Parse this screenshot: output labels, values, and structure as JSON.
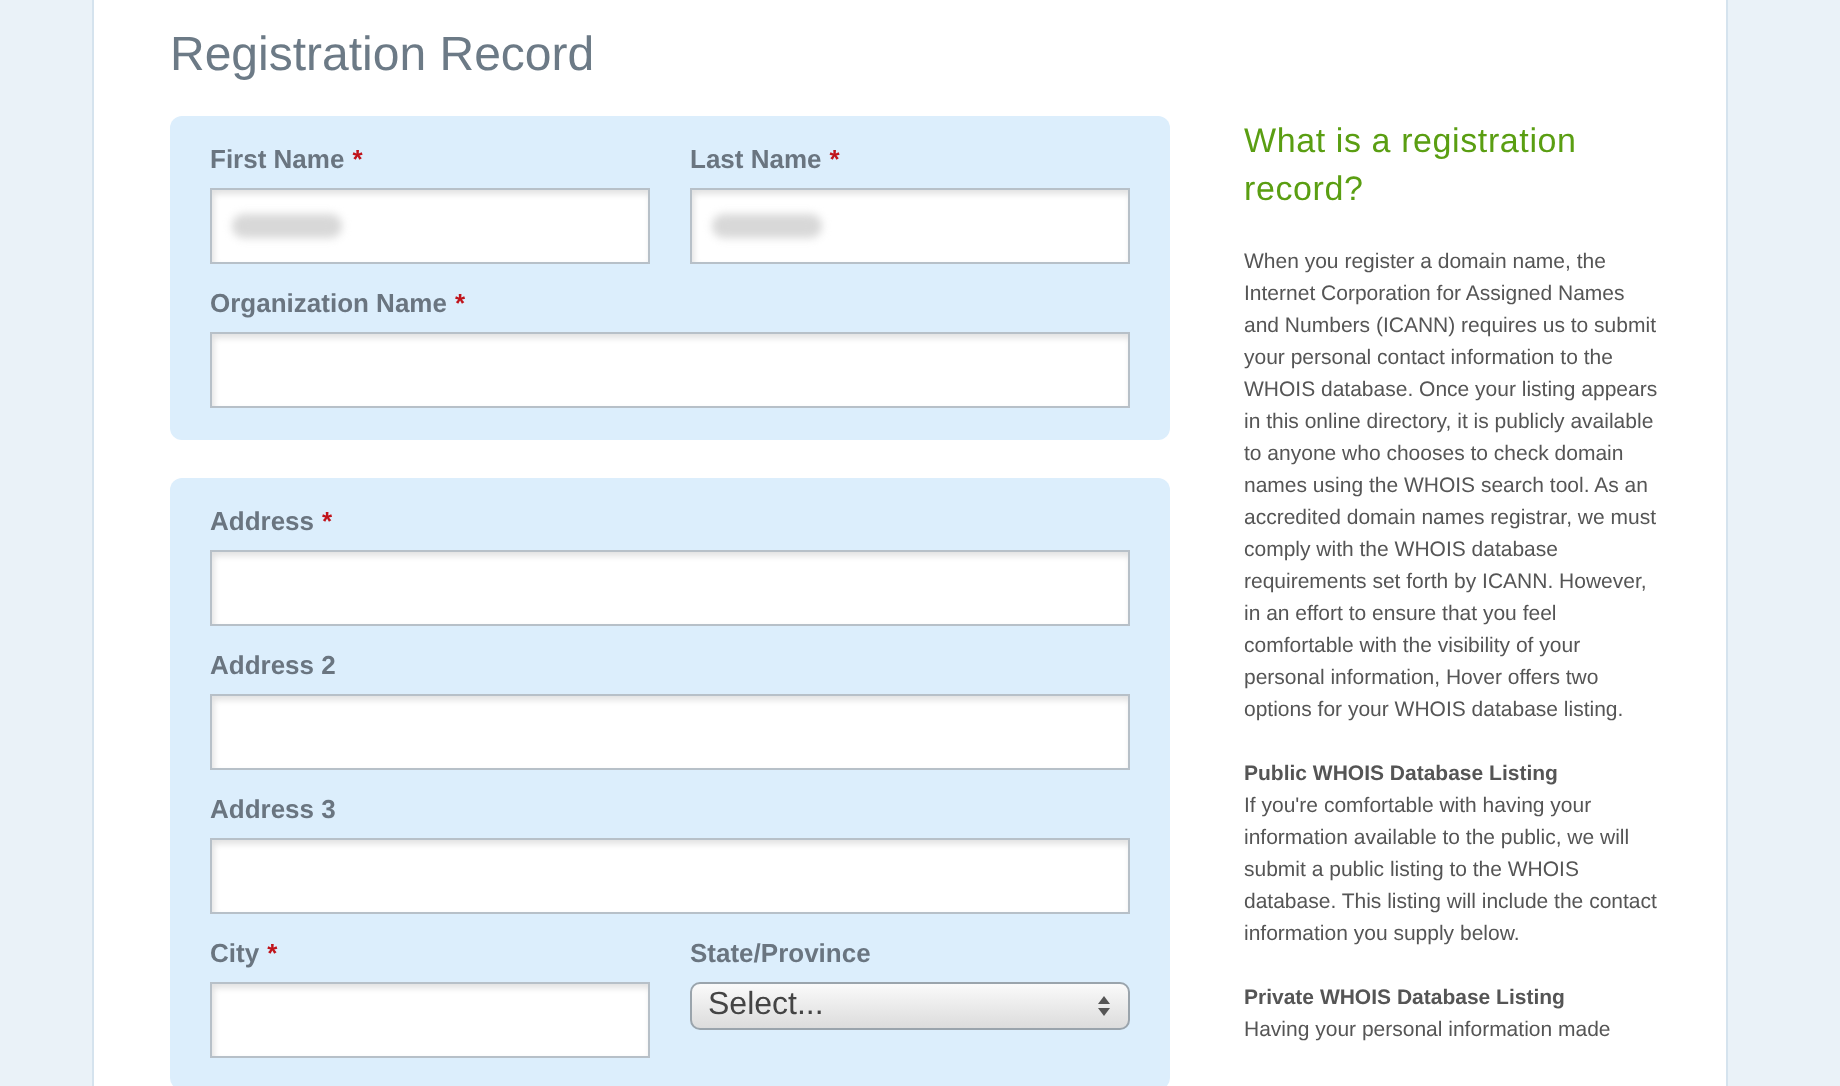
{
  "page_title": "Registration Record",
  "groups": [
    {
      "rows": [
        [
          {
            "label": "First Name",
            "required_mark": "*",
            "kind": "text",
            "redacted": true
          },
          {
            "label": "Last Name",
            "required_mark": "*",
            "kind": "text",
            "redacted": true
          }
        ],
        [
          {
            "label": "Organization Name",
            "required_mark": "*",
            "kind": "text"
          }
        ]
      ]
    },
    {
      "rows": [
        [
          {
            "label": "Address",
            "required_mark": "*",
            "kind": "text"
          }
        ],
        [
          {
            "label": "Address 2",
            "kind": "text"
          }
        ],
        [
          {
            "label": "Address 3",
            "kind": "text"
          }
        ],
        [
          {
            "label": "City",
            "required_mark": "*",
            "kind": "text"
          },
          {
            "label": "State/Province",
            "kind": "select",
            "value": "Select..."
          }
        ]
      ]
    }
  ],
  "sidebar": {
    "heading": "What is a registration record?",
    "intro": "When you register a domain name, the Internet Corporation for Assigned Names and Numbers (ICANN) requires us to submit your personal contact information to the WHOIS database. Once your listing appears in this online directory, it is publicly available to anyone who chooses to check domain names using the WHOIS search tool. As an accredited domain names registrar, we must comply with the WHOIS database requirements set forth by ICANN. However, in an effort to ensure that you feel comfortable with the visibility of your personal information, Hover offers two options for your WHOIS database listing.",
    "sections": [
      {
        "title": "Public WHOIS Database Listing",
        "text": "If you're comfortable with having your information available to the public, we will submit a public listing to the WHOIS database. This listing will include the contact information you supply below."
      },
      {
        "title": "Private WHOIS Database Listing",
        "text": "Having your personal information made"
      }
    ]
  }
}
